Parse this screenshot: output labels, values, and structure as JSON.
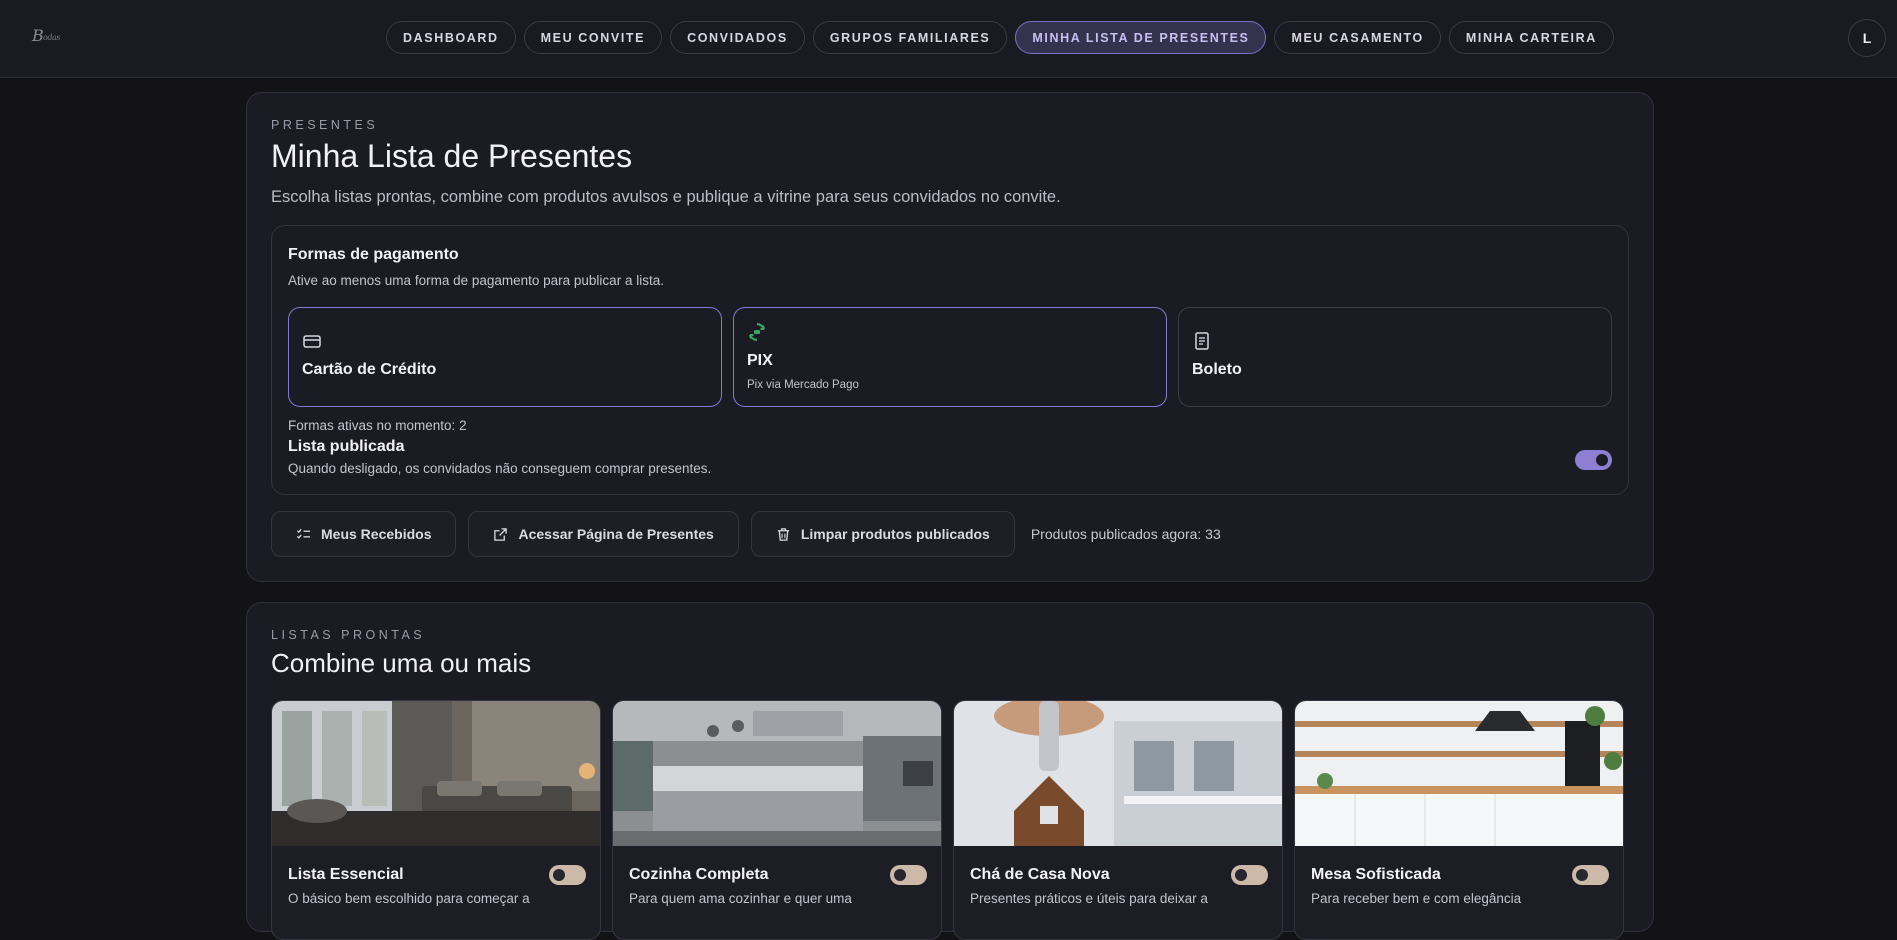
{
  "app": {
    "logo_text": "Bodas"
  },
  "nav": {
    "items": [
      {
        "label": "DASHBOARD"
      },
      {
        "label": "MEU CONVITE"
      },
      {
        "label": "CONVIDADOS"
      },
      {
        "label": "GRUPOS FAMILIARES"
      },
      {
        "label": "MINHA LISTA DE PRESENTES"
      },
      {
        "label": "MEU CASAMENTO"
      },
      {
        "label": "MINHA CARTEIRA"
      }
    ],
    "active_index": 4,
    "avatar_initial": "L"
  },
  "gifts": {
    "eyebrow": "PRESENTES",
    "title": "Minha Lista de Presentes",
    "subtitle": "Escolha listas prontas, combine com produtos avulsos e publique a vitrine para seus convidados no convite.",
    "payment": {
      "title": "Formas de pagamento",
      "subtitle": "Ative ao menos uma forma de pagamento para publicar a lista.",
      "methods": [
        {
          "name": "Cartão de Crédito",
          "icon": "credit-card-icon",
          "desc": "",
          "active": true
        },
        {
          "name": "PIX",
          "icon": "pix-icon",
          "desc": "Pix via Mercado Pago",
          "active": true
        },
        {
          "name": "Boleto",
          "icon": "boleto-icon",
          "desc": "",
          "active": false
        }
      ],
      "active_count": "Formas ativas no momento: 2",
      "published_title": "Lista publicada",
      "published_subtitle": "Quando desligado, os convidados não conseguem comprar presentes.",
      "published_on": true
    },
    "actions": {
      "received_label": "Meus Recebidos",
      "open_page_label": "Acessar Página de Presentes",
      "clear_label": "Limpar produtos publicados",
      "published_now": "Produtos publicados agora: 33"
    }
  },
  "lists": {
    "eyebrow": "LISTAS PRONTAS",
    "title": "Combine uma ou mais",
    "cards": [
      {
        "title": "Lista Essencial",
        "desc": "O básico bem escolhido para começar a",
        "enabled": false
      },
      {
        "title": "Cozinha Completa",
        "desc": "Para quem ama cozinhar e quer uma",
        "enabled": false
      },
      {
        "title": "Chá de Casa Nova",
        "desc": "Presentes práticos e úteis para deixar a",
        "enabled": false
      },
      {
        "title": "Mesa Sofisticada",
        "desc": "Para receber bem e com elegância",
        "enabled": false
      }
    ]
  },
  "colors": {
    "accent": "#8e7fd2",
    "background": "#121217",
    "panel": "#1b1c23",
    "toggle_off": "#cdb9a7",
    "pix_green": "#3aa36b"
  }
}
